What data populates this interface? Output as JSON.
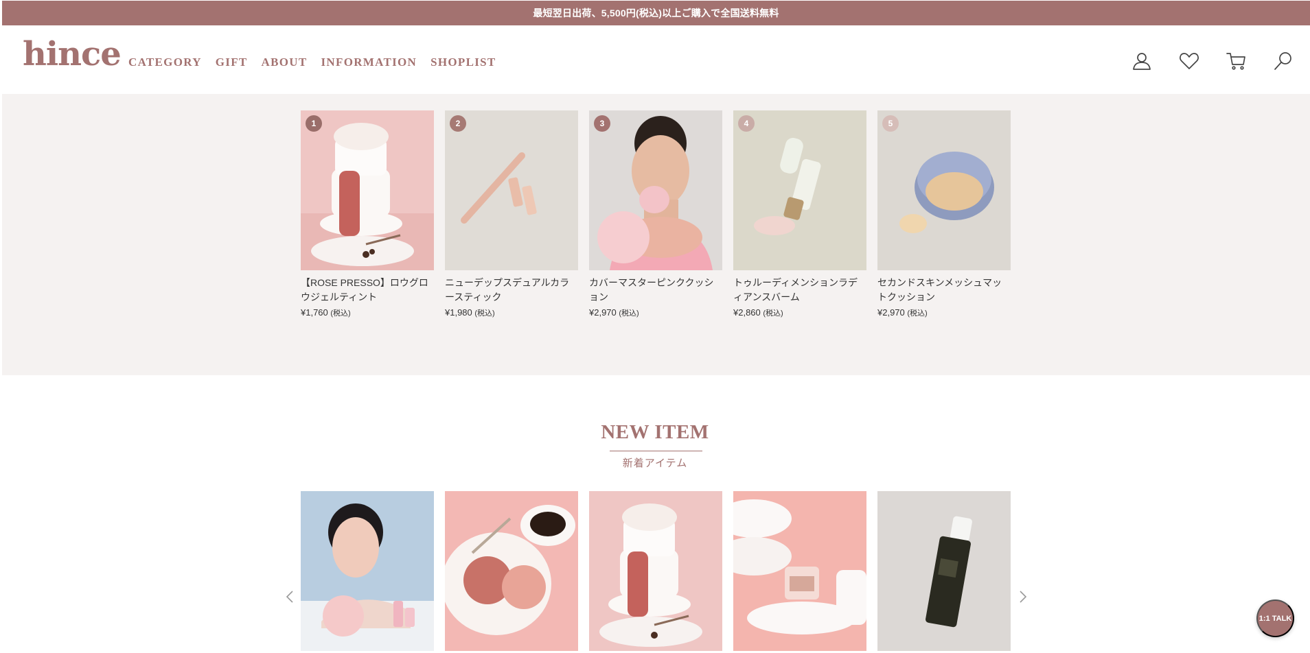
{
  "announcement": "最短翌日出荷、5,500円(税込)以上ご購入で全国送料無料",
  "header": {
    "logo": "hince",
    "nav": [
      "CATEGORY",
      "GIFT",
      "ABOUT",
      "INFORMATION",
      "SHOPLIST"
    ],
    "icons": [
      "user-icon",
      "heart-icon",
      "cart-icon",
      "search-icon"
    ]
  },
  "best": {
    "tax_label": "(税込)",
    "items": [
      {
        "rank": "1",
        "name": "【ROSE PRESSO】ロウグロウジェルティント",
        "price": "¥1,760"
      },
      {
        "rank": "2",
        "name": "ニューデップスデュアルカラースティック",
        "price": "¥1,980"
      },
      {
        "rank": "3",
        "name": "カバーマスターピンククッション",
        "price": "¥2,970"
      },
      {
        "rank": "4",
        "name": "トゥルーディメンションラディアンスバーム",
        "price": "¥2,860"
      },
      {
        "rank": "5",
        "name": "セカンドスキンメッシュマットクッション",
        "price": "¥2,970"
      }
    ],
    "rank_colors": [
      "#9a6e6a",
      "#a67a74",
      "#a37270",
      "#c9aca7",
      "#d6bdb8"
    ]
  },
  "new_item": {
    "title": "NEW ITEM",
    "subtitle": "新着アイテム"
  },
  "talk_button": "1:1 TALK",
  "colors": {
    "brand": "#a37270",
    "best_bg": "#f5f2f1"
  }
}
